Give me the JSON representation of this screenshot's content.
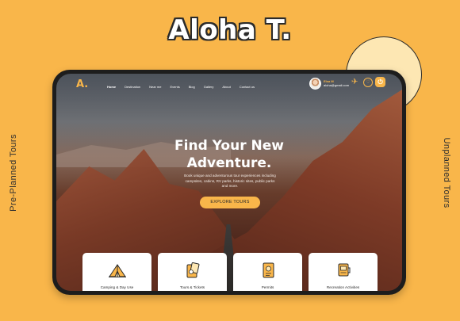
{
  "brand": {
    "title": "Aloha T."
  },
  "side_labels": {
    "left": "Pre-Planned Tours",
    "right": "Unplanned Tours"
  },
  "app": {
    "logo": "A.",
    "nav": [
      "Home",
      "Destination",
      "Near me",
      "Events",
      "Blog",
      "Gallery",
      "About",
      "Contact us"
    ],
    "active_nav": "Home",
    "user": {
      "name": "Elsa M",
      "email": "aloha@gmail.com"
    },
    "icons": {
      "plane": "plane-icon",
      "favorite": "heart-icon",
      "power": "power-icon"
    }
  },
  "hero": {
    "title_line1": "Find Your New",
    "title_line2": "Adventure.",
    "subtitle": "Book unique and adventurous tour experiences including campsites, cabins, RV parks, historic sites, public parks and more.",
    "cta": "EXPLORE TOURS"
  },
  "categories": [
    {
      "label": "Camping & Day Use",
      "icon": "tent-icon"
    },
    {
      "label": "Tours & Tickets",
      "icon": "ticket-icon"
    },
    {
      "label": "Permits",
      "icon": "permit-icon"
    },
    {
      "label": "Recreation Activities",
      "icon": "activities-icon"
    }
  ],
  "colors": {
    "accent": "#f9b64a",
    "dark": "#2b2b2b",
    "card": "#ffffff",
    "cream": "#fde7b3"
  }
}
